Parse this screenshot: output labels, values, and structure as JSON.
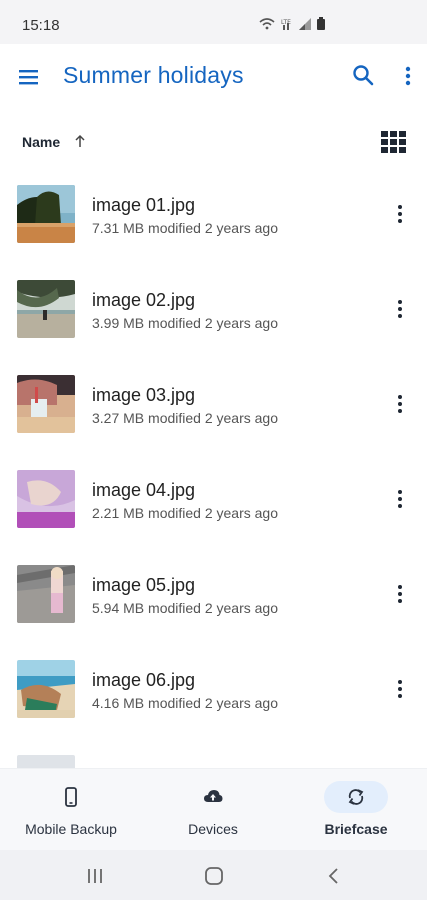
{
  "status_bar": {
    "time": "15:18"
  },
  "app_bar": {
    "title": "Summer holidays",
    "accent_color": "#1565c0"
  },
  "sort": {
    "label": "Name",
    "direction": "ascending"
  },
  "files": [
    {
      "name": "image 01.jpg",
      "meta": "7.31 MB modified 2 years ago"
    },
    {
      "name": "image 02.jpg",
      "meta": "3.99 MB modified 2 years ago"
    },
    {
      "name": "image 03.jpg",
      "meta": "3.27 MB modified 2 years ago"
    },
    {
      "name": "image 04.jpg",
      "meta": "2.21 MB modified 2 years ago"
    },
    {
      "name": "image 05.jpg",
      "meta": "5.94 MB modified 2 years ago"
    },
    {
      "name": "image 06.jpg",
      "meta": "4.16 MB modified 2 years ago"
    }
  ],
  "bottom_nav": {
    "items": [
      {
        "label": "Mobile Backup",
        "icon": "phone-icon"
      },
      {
        "label": "Devices",
        "icon": "cloud-upload-icon"
      },
      {
        "label": "Briefcase",
        "icon": "sync-icon",
        "active": true
      }
    ]
  }
}
